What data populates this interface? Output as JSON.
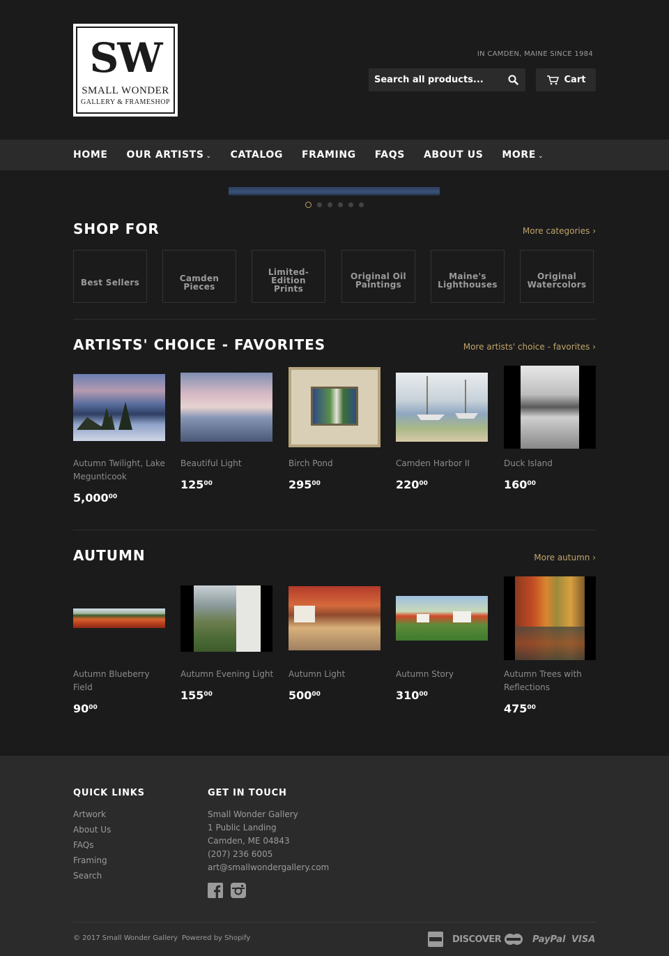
{
  "header": {
    "logo_mark": "SW",
    "logo_name": "SMALL WONDER",
    "logo_sub": "GALLERY & FRAMESHOP",
    "tagline": "IN CAMDEN, MAINE SINCE 1984",
    "search_placeholder": "Search all products...",
    "cart_label": "Cart"
  },
  "nav": {
    "items": [
      {
        "label": "HOME"
      },
      {
        "label": "OUR ARTISTS"
      },
      {
        "label": "CATALOG"
      },
      {
        "label": "FRAMING"
      },
      {
        "label": "FAQS"
      },
      {
        "label": "ABOUT US"
      },
      {
        "label": "MORE"
      }
    ]
  },
  "slider": {
    "slide_count": 6,
    "active_index": 0
  },
  "shop_for": {
    "title": "SHOP FOR",
    "more_link": "More categories ›",
    "categories": [
      {
        "line1": "Best Sellers",
        "line2": ""
      },
      {
        "line1": "Camden Pieces",
        "line2": ""
      },
      {
        "line1": "Limited-Edition",
        "line2": "Prints"
      },
      {
        "line1": "Original Oil",
        "line2": "Paintings"
      },
      {
        "line1": "Maine's",
        "line2": "Lighthouses"
      },
      {
        "line1": "Original",
        "line2": "Watercolors"
      }
    ]
  },
  "favorites": {
    "title": "ARTISTS' CHOICE - FAVORITES",
    "more_link": "More artists' choice - favorites ›",
    "products": [
      {
        "name": "Autumn Twilight, Lake Megunticook",
        "price": "5,000",
        "cents": "00"
      },
      {
        "name": "Beautiful Light",
        "price": "125",
        "cents": "00"
      },
      {
        "name": "Birch Pond",
        "price": "295",
        "cents": "00"
      },
      {
        "name": "Camden Harbor II",
        "price": "220",
        "cents": "00"
      },
      {
        "name": "Duck Island",
        "price": "160",
        "cents": "00"
      }
    ]
  },
  "autumn": {
    "title": "AUTUMN",
    "more_link": "More autumn ›",
    "products": [
      {
        "name": "Autumn Blueberry Field",
        "price": "90",
        "cents": "00"
      },
      {
        "name": "Autumn Evening Light",
        "price": "155",
        "cents": "00"
      },
      {
        "name": "Autumn Light",
        "price": "500",
        "cents": "00"
      },
      {
        "name": "Autumn Story",
        "price": "310",
        "cents": "00"
      },
      {
        "name": "Autumn Trees with Reflections",
        "price": "475",
        "cents": "00"
      }
    ]
  },
  "footer": {
    "quick_links_title": "QUICK LINKS",
    "quick_links": [
      "Artwork",
      "About Us",
      "FAQs",
      "Framing",
      "Search"
    ],
    "contact_title": "GET IN TOUCH",
    "contact_lines": [
      "Small Wonder Gallery",
      "1 Public Landing",
      "Camden, ME 04843",
      "(207) 236 6005",
      "art@smallwondergallery.com"
    ],
    "copyright": "© 2017 Small Wonder Gallery",
    "powered": "Powered by Shopify",
    "payments": [
      "DISCOVER",
      "PayPal",
      "VISA"
    ]
  }
}
